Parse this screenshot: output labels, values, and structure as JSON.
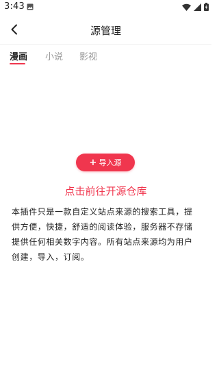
{
  "status_bar": {
    "time": "3:43",
    "icons": [
      "image-notification-icon",
      "wifi-icon",
      "signal-icon",
      "battery-charging-icon"
    ]
  },
  "header": {
    "title": "源管理",
    "back_icon": "chevron-left-icon"
  },
  "tabs": [
    {
      "label": "漫画",
      "active": true
    },
    {
      "label": "小说",
      "active": false
    },
    {
      "label": "影视",
      "active": false
    }
  ],
  "empty_state": {
    "import_button": {
      "icon": "+",
      "label": "导入源"
    },
    "link_text": "点击前往开源仓库",
    "description": "本插件只是一款自定义站点来源的搜索工具，提供方便，快捷，舒适的阅读体验，服务器不存储提供任何相关数字内容。所有站点来源均为用户创建，导入，订阅。"
  },
  "colors": {
    "accent": "#f0364e",
    "text_primary": "#222222",
    "text_inactive": "#9a9a9a",
    "background": "#ffffff"
  }
}
